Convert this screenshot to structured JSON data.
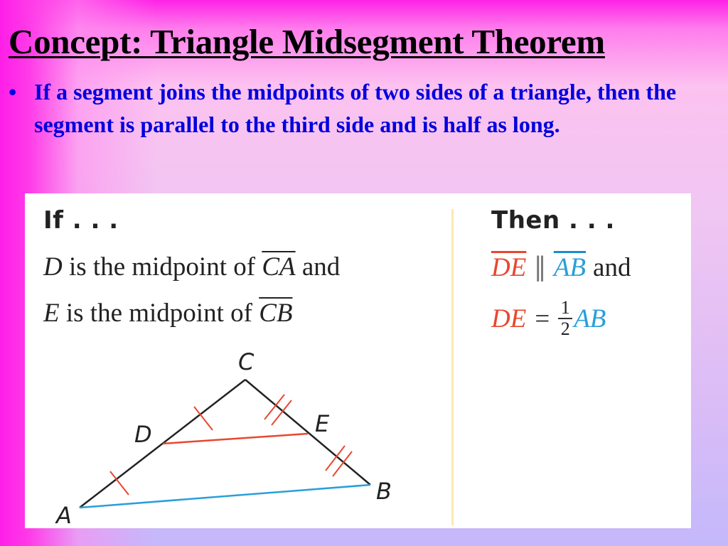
{
  "slide": {
    "title": "Concept:  Triangle Midsegment Theorem",
    "bullet_marker": "•",
    "bullet_text": "If a segment joins the midpoints of two sides of a triangle, then the segment is parallel to the third side and is half as long."
  },
  "figure": {
    "if_heading": "If . . .",
    "then_heading": "Then . . .",
    "conditions": [
      {
        "var": "D",
        "text": " is the midpoint of ",
        "segment": "CA",
        "suffix": " and"
      },
      {
        "var": "E",
        "text": " is the midpoint of ",
        "segment": "CB",
        "suffix": ""
      }
    ],
    "results": {
      "parallel": {
        "left": "DE",
        "symbol": "∥",
        "right": "AB",
        "suffix": "and"
      },
      "length": {
        "left": "DE",
        "equals": "=",
        "numerator": "1",
        "denominator": "2",
        "right": "AB"
      }
    },
    "triangle": {
      "vertices": {
        "A": "A",
        "B": "B",
        "C": "C",
        "D": "D",
        "E": "E"
      },
      "colors": {
        "midsegment": "#e8472e",
        "base": "#2a9fd8",
        "sides": "#222222",
        "ticks": "#e8472e"
      }
    }
  }
}
